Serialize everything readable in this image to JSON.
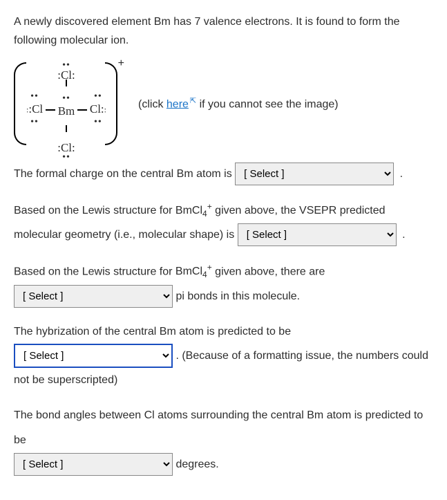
{
  "intro": "A newly discovered element Bm has 7 valence electrons. It is found to form the following molecular ion.",
  "lewis": {
    "charge": "+",
    "cl_top": ":Cl:",
    "cl_left": ":Cl",
    "center": "Bm",
    "cl_right": "Cl:",
    "cl_bottom": ":Cl:"
  },
  "img_caption_pre": "(click ",
  "img_link": "here",
  "img_caption_post": " if you cannot see the image)",
  "formula_plain": "BmCl",
  "formula_sub": "4",
  "formula_sup": "+",
  "q1_pre": "The formal charge on the central Bm atom is ",
  "q2_p1": "Based on the Lewis structure for ",
  "q2_p2": " given above, the VSEPR predicted molecular geometry (i.e., molecular shape) is ",
  "q3_p1": "Based on the Lewis structure for ",
  "q3_p2": " given above, there are",
  "q3_post": " pi bonds in this molecule.",
  "q4_pre": "The hybrization of the central Bm atom is predicted to be",
  "q4_post": " . (Because of a formatting issue, the numbers could not be superscripted)",
  "q5_pre": "The bond angles between Cl atoms surrounding the central Bm atom is predicted to be",
  "q5_post": " degrees.",
  "select_placeholder": "[ Select ]",
  "period": "."
}
